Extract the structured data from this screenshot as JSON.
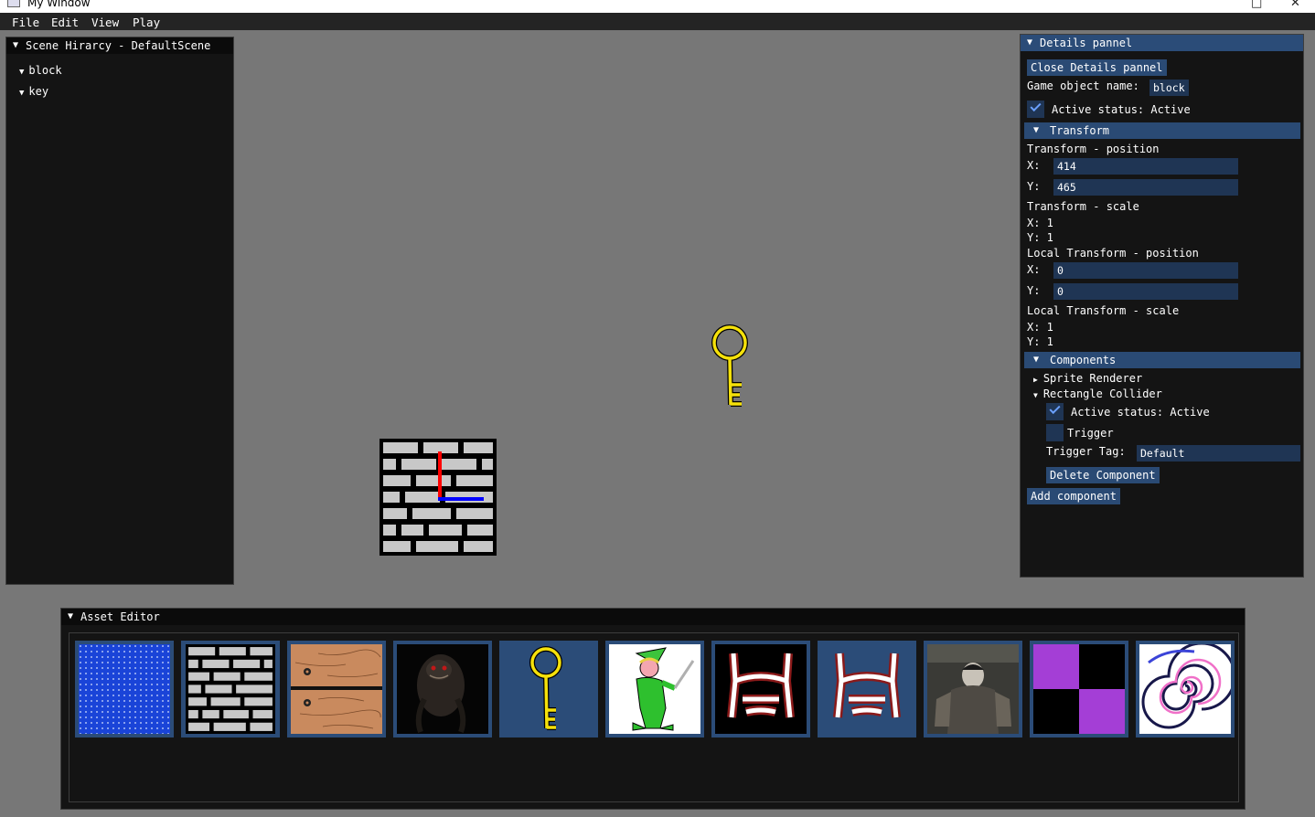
{
  "window": {
    "title": "My Window"
  },
  "menu": {
    "items": [
      "File",
      "Edit",
      "View",
      "Play"
    ]
  },
  "hierarchy": {
    "title": "Scene Hirarcy - DefaultScene",
    "items": [
      "block",
      "key"
    ]
  },
  "details": {
    "title": "Details pannel",
    "close_button": "Close Details pannel",
    "name_label": "Game object name:",
    "name_value": "block",
    "active_label": "Active status: Active",
    "transform_header": "Transform",
    "tp_label": "Transform - position",
    "tp_x_label": "X:",
    "tp_x": "414",
    "tp_y_label": "Y:",
    "tp_y": "465",
    "ts_label": "Transform - scale",
    "ts_x": "X: 1",
    "ts_y": "Y: 1",
    "ltp_label": "Local Transform - position",
    "ltp_x_label": "X:",
    "ltp_x": "0",
    "ltp_y_label": "Y:",
    "ltp_y": "0",
    "lts_label": "Local Transform - scale",
    "lts_x": "X: 1",
    "lts_y": "Y: 1",
    "components_header": "Components",
    "sprite_renderer": "Sprite Renderer",
    "rect_collider": "Rectangle Collider",
    "rc_active_label": "Active status: Active",
    "rc_trigger_label": "Trigger",
    "rc_trigger_tag_label": "Trigger Tag:",
    "rc_trigger_tag_value": "Default",
    "delete_component": "Delete Component",
    "add_component": "Add component"
  },
  "asset_editor": {
    "title": "Asset Editor",
    "assets": [
      "water-texture",
      "brick-texture",
      "wood-crate",
      "monster-portrait",
      "key-sprite",
      "elf-with-sword",
      "creature-red-black",
      "creature-blue",
      "armored-figure",
      "checker-purple",
      "spiral-portal"
    ]
  },
  "colors": {
    "panel_bg": "#141414",
    "accent": "#2a4a74",
    "viewport_bg": "#777777"
  }
}
